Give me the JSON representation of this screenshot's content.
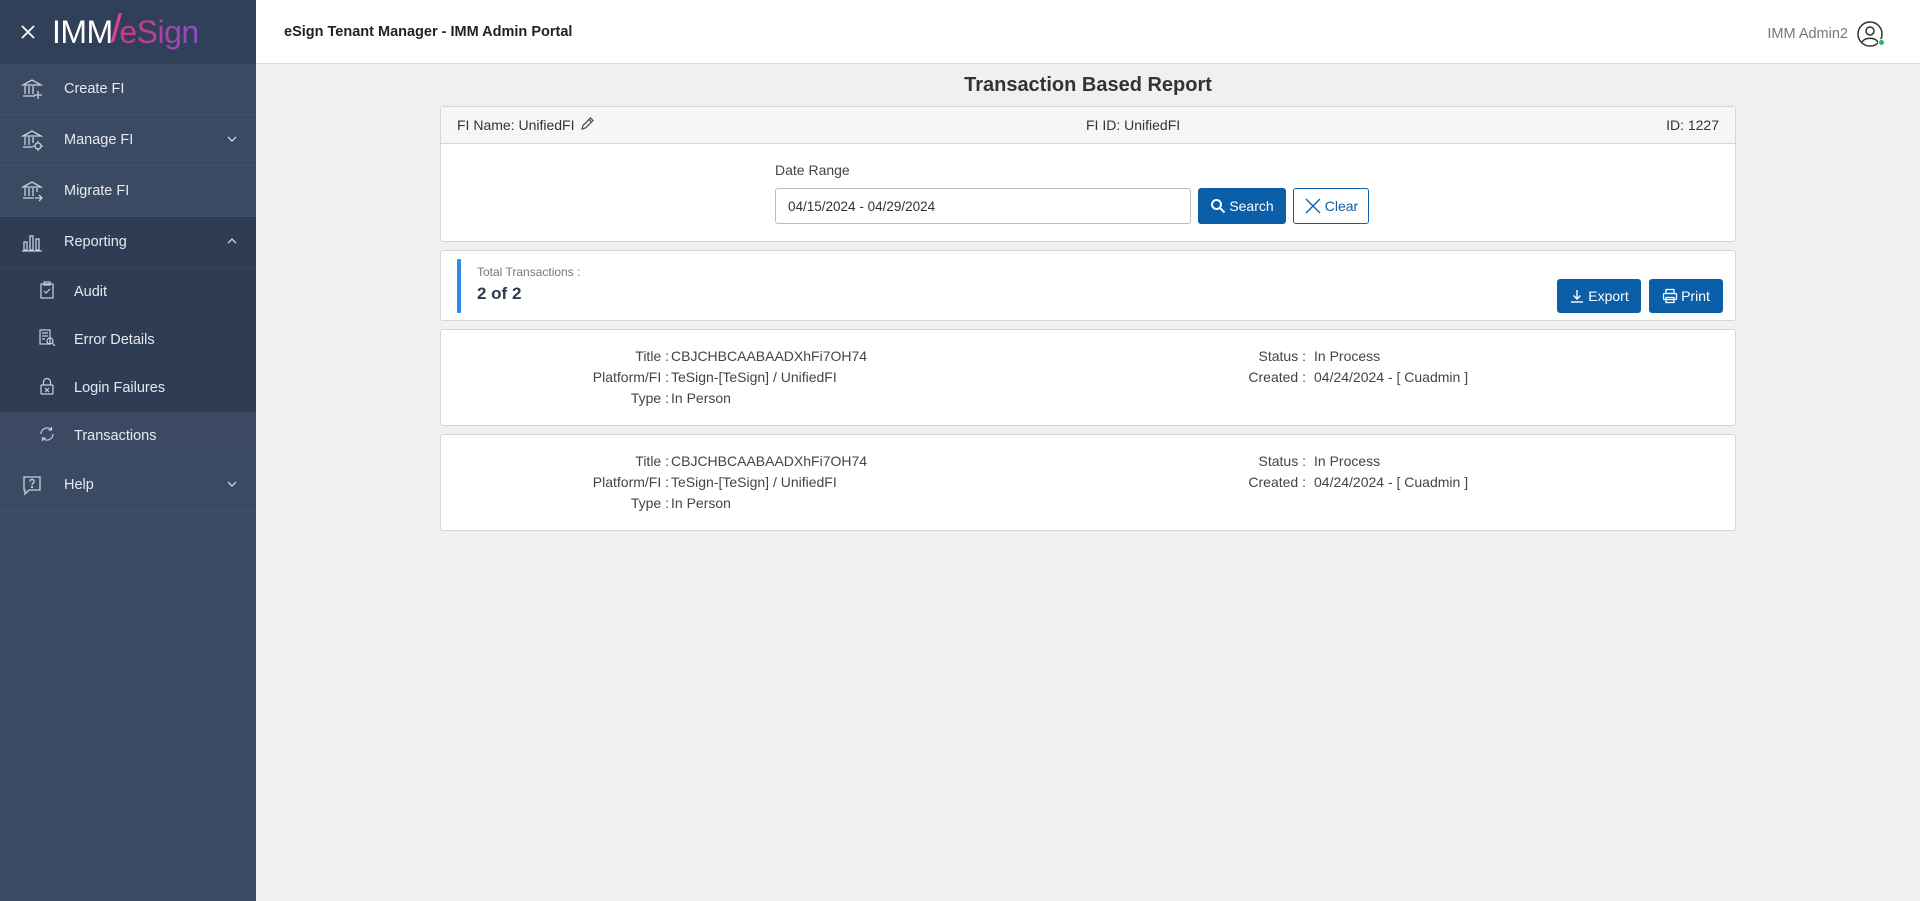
{
  "sidebar": {
    "logo_left": "IMM",
    "logo_slash": "/",
    "logo_right": "eSign",
    "items": [
      {
        "label": "Create FI"
      },
      {
        "label": "Manage FI"
      },
      {
        "label": "Migrate FI"
      },
      {
        "label": "Reporting"
      },
      {
        "label": "Help"
      }
    ],
    "reporting_sub": [
      {
        "label": "Audit"
      },
      {
        "label": "Error Details"
      },
      {
        "label": "Login Failures"
      },
      {
        "label": "Transactions",
        "active": true
      }
    ]
  },
  "header": {
    "title": "eSign Tenant Manager - IMM Admin Portal",
    "user": "IMM Admin2"
  },
  "page": {
    "title": "Transaction Based Report"
  },
  "fi": {
    "name": "FI Name: UnifiedFI",
    "fi_id": "FI ID: UnifiedFI",
    "id": "ID: 1227"
  },
  "filter": {
    "date_range_label": "Date Range",
    "date_range_value": "04/15/2024 - 04/29/2024",
    "search_label": "Search",
    "clear_label": "Clear"
  },
  "summary": {
    "total_label": "Total Transactions :",
    "total_value": "2 of 2",
    "export_label": "Export",
    "print_label": "Print"
  },
  "transactions": [
    {
      "title_k": "Title :",
      "title": "CBJCHBCAABAADXhFi7OH74",
      "platform_k": "Platform/FI :",
      "platform": "TeSign-[TeSign] / UnifiedFI",
      "type_k": "Type :",
      "type": "In Person",
      "status_k": "Status :",
      "status": "In Process",
      "created_k": "Created :",
      "created": "04/24/2024 - [ Cuadmin ]"
    },
    {
      "title_k": "Title :",
      "title": "CBJCHBCAABAADXhFi7OH74",
      "platform_k": "Platform/FI :",
      "platform": "TeSign-[TeSign] / UnifiedFI",
      "type_k": "Type :",
      "type": "In Person",
      "status_k": "Status :",
      "status": "In Process",
      "created_k": "Created :",
      "created": "04/24/2024 - [ Cuadmin ]"
    }
  ],
  "colors": {
    "sidebar_bg": "#3a4a62",
    "primary": "#0b5ea8",
    "accent_bar": "#2f8be6"
  }
}
